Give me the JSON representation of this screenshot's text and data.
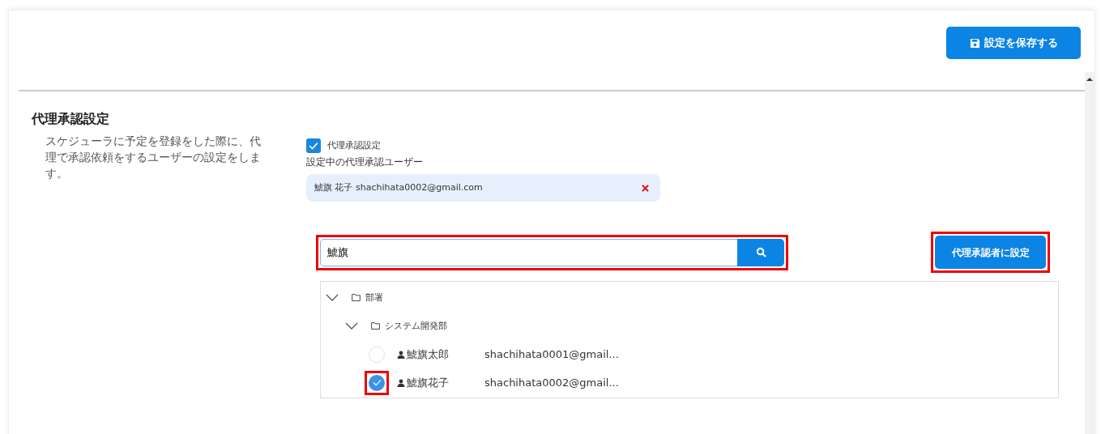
{
  "header": {
    "save_button": "設定を保存する"
  },
  "section": {
    "title": "代理承認設定",
    "description": "スケジューラに予定を登録をした際に、代理で承認依頼をするユーザーの設定をします。"
  },
  "proxy_setting": {
    "label": "代理承認設定",
    "checked": true
  },
  "current_label": "設定中の代理承認ユーザー",
  "current_user": {
    "name": "鯱旗 花子",
    "email": "shachihata0002@gmail.com"
  },
  "search": {
    "value": "鯱旗",
    "highlighted": true
  },
  "assign_button": {
    "label": "代理承認者に設定",
    "highlighted": true
  },
  "tree": [
    {
      "kind": "folder",
      "label": "部署",
      "expanded": true,
      "children": [
        {
          "kind": "folder",
          "label": "システム開発部",
          "expanded": true,
          "children": [
            {
              "kind": "user",
              "label": "鯱旗太郎",
              "email": "shachihata0001@gmail...",
              "selected": false,
              "highlighted": false
            },
            {
              "kind": "user",
              "label": "鯱旗花子",
              "email": "shachihata0002@gmail...",
              "selected": true,
              "highlighted": true
            }
          ]
        }
      ]
    }
  ]
}
